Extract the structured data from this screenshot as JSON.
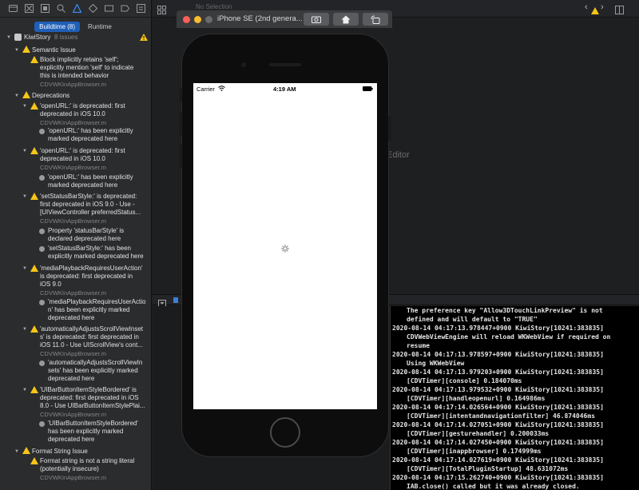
{
  "navigator": {
    "tabs": [
      "Buildtime (8)",
      "Runtime"
    ],
    "project": {
      "name": "KiwiStory",
      "count": "8 issues"
    },
    "semantic": {
      "title": "Semantic Issue",
      "issue_lines": [
        "Block implicitly retains 'self';",
        "explicitly mention 'self' to indicate",
        "this is intended behavior"
      ],
      "file": "CDVWKInAppBrowser.m"
    },
    "deprecations": {
      "title": "Deprecations",
      "d1_lines": [
        "'openURL:' is deprecated: first",
        "deprecated in iOS 10.0"
      ],
      "d1_file": "CDVWKInAppBrowser.m",
      "d1_note": [
        "'openURL:' has been explicitly",
        "marked deprecated here"
      ],
      "d2_lines": [
        "'openURL:' is deprecated: first",
        "deprecated in iOS 10.0"
      ],
      "d2_file": "CDVWKInAppBrowser.m",
      "d2_note": [
        "'openURL:' has been explicitly",
        "marked deprecated here"
      ],
      "d3_lines": [
        "'setStatusBarStyle:' is deprecated:",
        "first deprecated in iOS 9.0 - Use -",
        "[UIViewController preferredStatus..."
      ],
      "d3_file": "CDVWKInAppBrowser.m",
      "d3_note1": [
        "Property 'statusBarStyle' is",
        "declared deprecated here"
      ],
      "d3_note2": [
        "'setStatusBarStyle:' has been",
        "explicitly marked deprecated here"
      ],
      "d4_lines": [
        "'mediaPlaybackRequiresUserAction'",
        "is deprecated: first deprecated in",
        "iOS 9.0"
      ],
      "d4_file": "CDVWKInAppBrowser.m",
      "d4_note": [
        "'mediaPlaybackRequiresUserActio",
        "n' has been explicitly marked",
        "deprecated here"
      ],
      "d5_lines": [
        "'automaticallyAdjustsScrollViewInset",
        "s' is deprecated: first deprecated in",
        "iOS 11.0 - Use UIScrollView's cont..."
      ],
      "d5_file": "CDVWKInAppBrowser.m",
      "d5_note": [
        "'automaticallyAdjustsScrollViewIn",
        "sets' has been explicitly marked",
        "deprecated here"
      ],
      "d6_lines": [
        "'UIBarButtonItemStyleBordered' is",
        "deprecated: first deprecated in iOS",
        "8.0 - Use UIBarButtonItemStylePlai..."
      ],
      "d6_file": "CDVWKInAppBrowser.m",
      "d6_note": [
        "'UIBarButtonItemStyleBordered'",
        "has been explicitly marked",
        "deprecated here"
      ]
    },
    "format": {
      "title": "Format String Issue",
      "issue_lines": [
        "Format string is not a string literal",
        "(potentially insecure)"
      ],
      "file": "CDVWKInAppBrowser.m"
    }
  },
  "editor": {
    "no_selection": "No Selection",
    "placeholder": "Editor"
  },
  "simulator": {
    "device": "iPhone SE (2nd genera...",
    "carrier": "Carrier",
    "time": "4:19 AM"
  },
  "console": {
    "lines": [
      {
        "t": "The preference key \"Allow3DTouchLinkPreview\" is not",
        "i": true
      },
      {
        "t": "defined and will default to \"TRUE\"",
        "i": true
      },
      {
        "t": "2020-08-14 04:17:13.978447+0900 KiwiStory[10241:383835]",
        "i": false
      },
      {
        "t": "CDVWebViewEngine will reload WKWebView if required on",
        "i": true
      },
      {
        "t": "resume",
        "i": true
      },
      {
        "t": "2020-08-14 04:17:13.978597+0900 KiwiStory[10241:383835]",
        "i": false
      },
      {
        "t": "Using WKWebView",
        "i": true
      },
      {
        "t": "2020-08-14 04:17:13.979203+0900 KiwiStory[10241:383835]",
        "i": false
      },
      {
        "t": "[CDVTimer][console] 0.184070ms",
        "i": true
      },
      {
        "t": "2020-08-14 04:17:13.979532+0900 KiwiStory[10241:383835]",
        "i": false
      },
      {
        "t": "[CDVTimer][handleopenurl] 0.164986ms",
        "i": true
      },
      {
        "t": "2020-08-14 04:17:14.026564+0900 KiwiStory[10241:383835]",
        "i": false
      },
      {
        "t": "[CDVTimer][intentandnavigationfilter] 46.874046ms",
        "i": true
      },
      {
        "t": "2020-08-14 04:17:14.027051+0900 KiwiStory[10241:383835]",
        "i": false
      },
      {
        "t": "[CDVTimer][gesturehandler] 0.200033ms",
        "i": true
      },
      {
        "t": "2020-08-14 04:17:14.027450+0900 KiwiStory[10241:383835]",
        "i": false
      },
      {
        "t": "[CDVTimer][inappbrowser] 0.174999ms",
        "i": true
      },
      {
        "t": "2020-08-14 04:17:14.027619+0900 KiwiStory[10241:383835]",
        "i": false
      },
      {
        "t": "[CDVTimer][TotalPluginStartup] 48.631072ms",
        "i": true
      },
      {
        "t": "2020-08-14 04:17:15.262740+0900 KiwiStory[10241:383835]",
        "i": false
      },
      {
        "t": "IAB.close() called but it was already closed.",
        "i": true
      }
    ]
  },
  "colors": {
    "warning": "#f5c518",
    "accent": "#1f5fb8"
  }
}
